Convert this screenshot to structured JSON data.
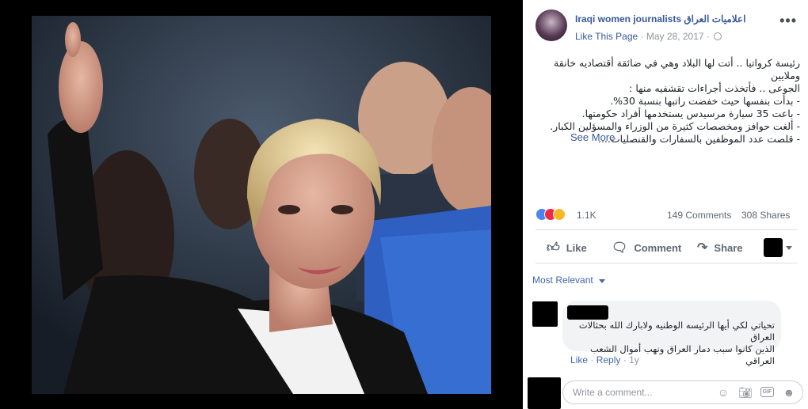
{
  "post": {
    "page_name_en": "Iraqi women journalists",
    "page_name_ar": "اعلاميات العراق",
    "like_page": "Like This Page",
    "dot": "·",
    "date": "May 28, 2017",
    "text_lines": [
      "رئيسة كرواتيا .. أتت لها البلاد وهي في ضائقة أقتصاديه خانقة وملايين",
      "الجوعى .. فأتخذت أجراءات تقشفيه منها :",
      "- بدأت بنفسها حيث خفضت راتبها بنسبة 30%.",
      "- باعت 35 سيارة مرسيدس يستخدمها أفراد حكومتها.",
      "- ألغت حوافز ومخصصات كثيرة من الوزراء والمسؤلين الكبار.",
      "- قلصت عدد الموظفين بالسفارات والقنصليات...."
    ],
    "see_more": "See More"
  },
  "stats": {
    "reactions_count": "1.1K",
    "comments": "149 Comments",
    "shares": "308 Shares"
  },
  "actions": {
    "like": "Like",
    "comment": "Comment",
    "share": "Share"
  },
  "comments_section": {
    "sort_label": "Most Relevant",
    "comment": {
      "text_lines": [
        "تحياتي لكي أيها الرئيسه الوطنيه ولابارك الله بحثالات العراق",
        "الذين كانوا سبب دمار العراق ونهب أموال الشعب العراقي"
      ],
      "like": "Like",
      "reply": "Reply",
      "age": "1y",
      "sep": "·"
    },
    "compose_placeholder": "Write a comment..."
  },
  "icons": {
    "more": "more-options-icon",
    "globe": "globe-icon",
    "like": "thumbs-up-icon",
    "comment": "comment-bubble-icon",
    "share": "share-arrow-icon",
    "emoji": "emoji-icon",
    "camera": "camera-icon",
    "gif": "gif-icon",
    "sticker": "sticker-icon"
  },
  "colors": {
    "link": "#385898",
    "accent": "#4267b2",
    "muted": "#90949c",
    "like_reaction": "#4b86f0",
    "love_reaction": "#f0284a",
    "haha_reaction": "#f7b928"
  }
}
